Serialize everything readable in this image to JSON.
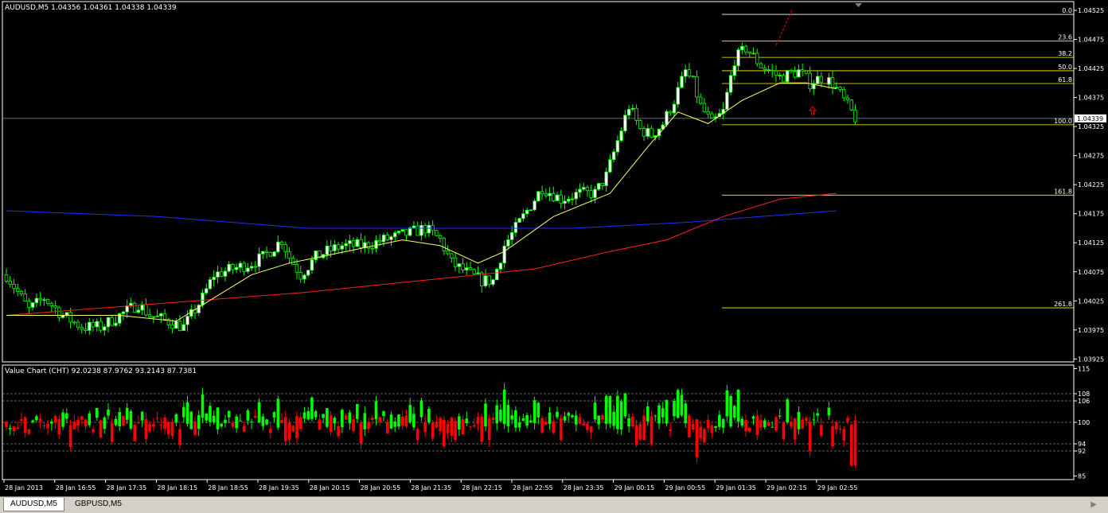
{
  "main_header": "AUDUSD,M5  1.04356 1.04361 1.04338 1.04339",
  "sub_header": "Value Chart (CHT) 92.0238 87.9762 93.2143 87.7381",
  "current_price": "1.04339",
  "tabs": [
    {
      "label": "AUDUSD,M5",
      "active": true
    },
    {
      "label": "GBPUSD,M5",
      "active": false
    }
  ],
  "colors": {
    "bull": "#00ff00",
    "bear": "#ff0000",
    "fib": "#ffff00",
    "ma_fast": "#ffff66",
    "ma_mid": "#ff2020",
    "ma_slow": "#2030ff",
    "bid": "#7f8fa0"
  },
  "chart_data": [
    {
      "type": "candlestick",
      "symbol": "AUDUSD",
      "timeframe": "M5",
      "ylim": [
        1.0392,
        1.0454
      ],
      "y_ticks": [
        "1.04525",
        "1.04475",
        "1.04425",
        "1.04375",
        "1.04325",
        "1.04275",
        "1.04225",
        "1.04175",
        "1.04125",
        "1.04075",
        "1.04025",
        "1.03975",
        "1.03925"
      ],
      "x_ticks": [
        "28 Jan 2013",
        "28 Jan 16:55",
        "28 Jan 17:35",
        "28 Jan 18:15",
        "28 Jan 18:55",
        "28 Jan 19:35",
        "28 Jan 20:15",
        "28 Jan 20:55",
        "28 Jan 21:35",
        "28 Jan 22:15",
        "28 Jan 22:55",
        "28 Jan 23:35",
        "29 Jan 00:15",
        "29 Jan 00:55",
        "29 Jan 01:35",
        "29 Jan 02:15",
        "29 Jan 02:55"
      ],
      "fib_levels": [
        {
          "label": "0.0",
          "price": 1.04518
        },
        {
          "label": "23.6",
          "price": 1.04472
        },
        {
          "label": "38.2",
          "price": 1.04444
        },
        {
          "label": "50.0",
          "price": 1.04421
        },
        {
          "label": "61.8",
          "price": 1.04399
        },
        {
          "label": "100.0",
          "price": 1.04328
        },
        {
          "label": "161.8",
          "price": 1.04207
        },
        {
          "label": "261.8",
          "price": 1.04013
        }
      ],
      "bid": 1.04339,
      "close_path": [
        [
          0,
          1.0407
        ],
        [
          6,
          1.0401
        ],
        [
          10,
          1.0403
        ],
        [
          15,
          1.04
        ],
        [
          20,
          1.0398
        ],
        [
          25,
          1.0398
        ],
        [
          30,
          1.04
        ],
        [
          35,
          1.0402
        ],
        [
          38,
          1.04
        ],
        [
          43,
          1.0399
        ],
        [
          47,
          1.0398
        ],
        [
          52,
          1.0403
        ],
        [
          55,
          1.0407
        ],
        [
          60,
          1.0408
        ],
        [
          65,
          1.0409
        ],
        [
          68,
          1.041
        ],
        [
          73,
          1.0413
        ],
        [
          75,
          1.041
        ],
        [
          78,
          1.0407
        ],
        [
          82,
          1.041
        ],
        [
          85,
          1.0411
        ],
        [
          89,
          1.0412
        ],
        [
          95,
          1.0412
        ],
        [
          100,
          1.0413
        ],
        [
          106,
          1.0414
        ],
        [
          111,
          1.0415
        ],
        [
          115,
          1.0413
        ],
        [
          118,
          1.0409
        ],
        [
          123,
          1.0407
        ],
        [
          126,
          1.0406
        ],
        [
          129,
          1.0406
        ],
        [
          132,
          1.0412
        ],
        [
          135,
          1.0415
        ],
        [
          138,
          1.0418
        ],
        [
          142,
          1.0422
        ],
        [
          147,
          1.042
        ],
        [
          152,
          1.0421
        ],
        [
          156,
          1.0421
        ],
        [
          159,
          1.0424
        ],
        [
          162,
          1.043
        ],
        [
          165,
          1.0436
        ],
        [
          168,
          1.0432
        ],
        [
          171,
          1.0431
        ],
        [
          174,
          1.0433
        ],
        [
          177,
          1.0437
        ],
        [
          180,
          1.0442
        ],
        [
          182,
          1.044
        ],
        [
          184,
          1.0436
        ],
        [
          187,
          1.0433
        ],
        [
          190,
          1.0435
        ],
        [
          193,
          1.0444
        ],
        [
          196,
          1.0446
        ],
        [
          200,
          1.0443
        ],
        [
          205,
          1.0441
        ],
        [
          210,
          1.0442
        ],
        [
          213,
          1.044
        ],
        [
          216,
          1.0441
        ],
        [
          219,
          1.044
        ],
        [
          225,
          1.0434
        ]
      ],
      "ma_fast": [
        [
          0,
          1.04
        ],
        [
          15,
          1.04
        ],
        [
          30,
          1.04
        ],
        [
          45,
          1.0399
        ],
        [
          55,
          1.0403
        ],
        [
          65,
          1.0407
        ],
        [
          75,
          1.0409
        ],
        [
          90,
          1.0411
        ],
        [
          105,
          1.0413
        ],
        [
          115,
          1.0412
        ],
        [
          125,
          1.0409
        ],
        [
          132,
          1.0411
        ],
        [
          145,
          1.0417
        ],
        [
          160,
          1.0421
        ],
        [
          170,
          1.0429
        ],
        [
          178,
          1.0435
        ],
        [
          186,
          1.0433
        ],
        [
          195,
          1.0437
        ],
        [
          205,
          1.044
        ],
        [
          212,
          1.044
        ],
        [
          220,
          1.0439
        ]
      ],
      "ma_mid": [
        [
          0,
          1.04
        ],
        [
          40,
          1.0402
        ],
        [
          80,
          1.0404
        ],
        [
          110,
          1.0406
        ],
        [
          140,
          1.0408
        ],
        [
          160,
          1.0411
        ],
        [
          175,
          1.0413
        ],
        [
          190,
          1.0417
        ],
        [
          205,
          1.042
        ],
        [
          220,
          1.0421
        ]
      ],
      "ma_slow": [
        [
          0,
          1.0418
        ],
        [
          40,
          1.0417
        ],
        [
          80,
          1.0415
        ],
        [
          120,
          1.0415
        ],
        [
          150,
          1.0415
        ],
        [
          180,
          1.0416
        ],
        [
          200,
          1.0417
        ],
        [
          220,
          1.0418
        ]
      ]
    },
    {
      "type": "candlestick",
      "name": "Value Chart (CHT)",
      "ylim": [
        84,
        116
      ],
      "y_ticks": [
        "115",
        "108",
        "106",
        "100",
        "94",
        "92",
        "85"
      ],
      "levels": [
        108,
        106,
        100,
        94,
        92
      ]
    }
  ]
}
